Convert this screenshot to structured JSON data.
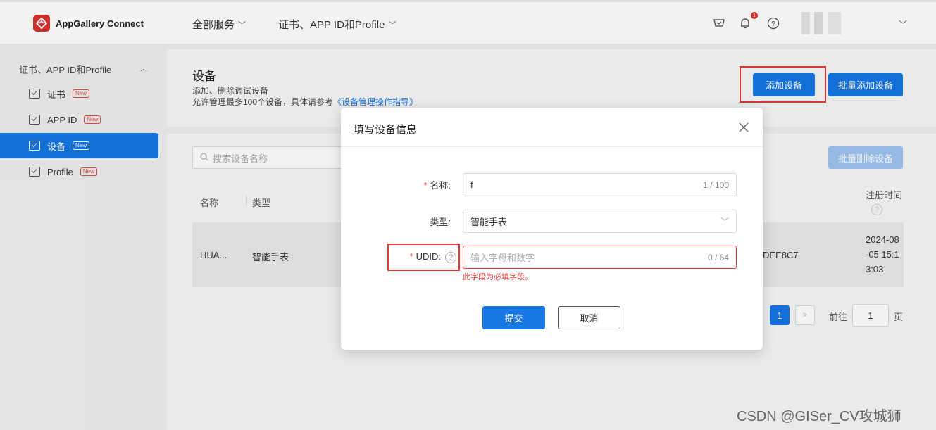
{
  "header": {
    "brand": "AppGallery Connect",
    "nav_all_services": "全部服务",
    "nav_certs": "证书、APP ID和Profile",
    "notification_count": "1"
  },
  "sidebar": {
    "group_label": "证书、APP ID和Profile",
    "items": [
      {
        "label": "证书",
        "tag": "New"
      },
      {
        "label": "APP ID",
        "tag": "New"
      },
      {
        "label": "设备",
        "tag": "New"
      },
      {
        "label": "Profile",
        "tag": "New"
      }
    ]
  },
  "page": {
    "title": "设备",
    "desc1": "添加、删除调试设备",
    "desc2_prefix": "允许管理最多100个设备，具体请参考",
    "desc2_link": "《设备管理操作指导》",
    "add_button": "添加设备",
    "batch_add_button": "批量添加设备",
    "batch_delete_button": "批量删除设备",
    "search_placeholder": "搜索设备名称"
  },
  "table": {
    "headers": {
      "name": "名称",
      "type": "类型",
      "registered": "注册时间"
    },
    "row": {
      "name": "HUA...",
      "type": "智能手表",
      "udid_suffix": "DEE8C7",
      "registered": [
        "2024-08",
        "-05 15:1",
        "3:03"
      ]
    }
  },
  "pagination": {
    "current_page": "1",
    "goto_label": "前往",
    "goto_value": "1",
    "page_suffix": "页"
  },
  "modal": {
    "title": "填写设备信息",
    "name_label": "名称:",
    "name_value": "f",
    "name_counter": "1 / 100",
    "type_label": "类型:",
    "type_value": "智能手表",
    "udid_label": "UDID:",
    "udid_placeholder": "输入字母和数字",
    "udid_counter": "0 / 64",
    "udid_error": "此字段为必填字段。",
    "submit_button": "提交",
    "cancel_button": "取消"
  },
  "watermark": "CSDN @GISer_CV攻城狮",
  "colors": {
    "primary": "#1677e5",
    "error": "#e53935",
    "brand": "#d8322d"
  }
}
